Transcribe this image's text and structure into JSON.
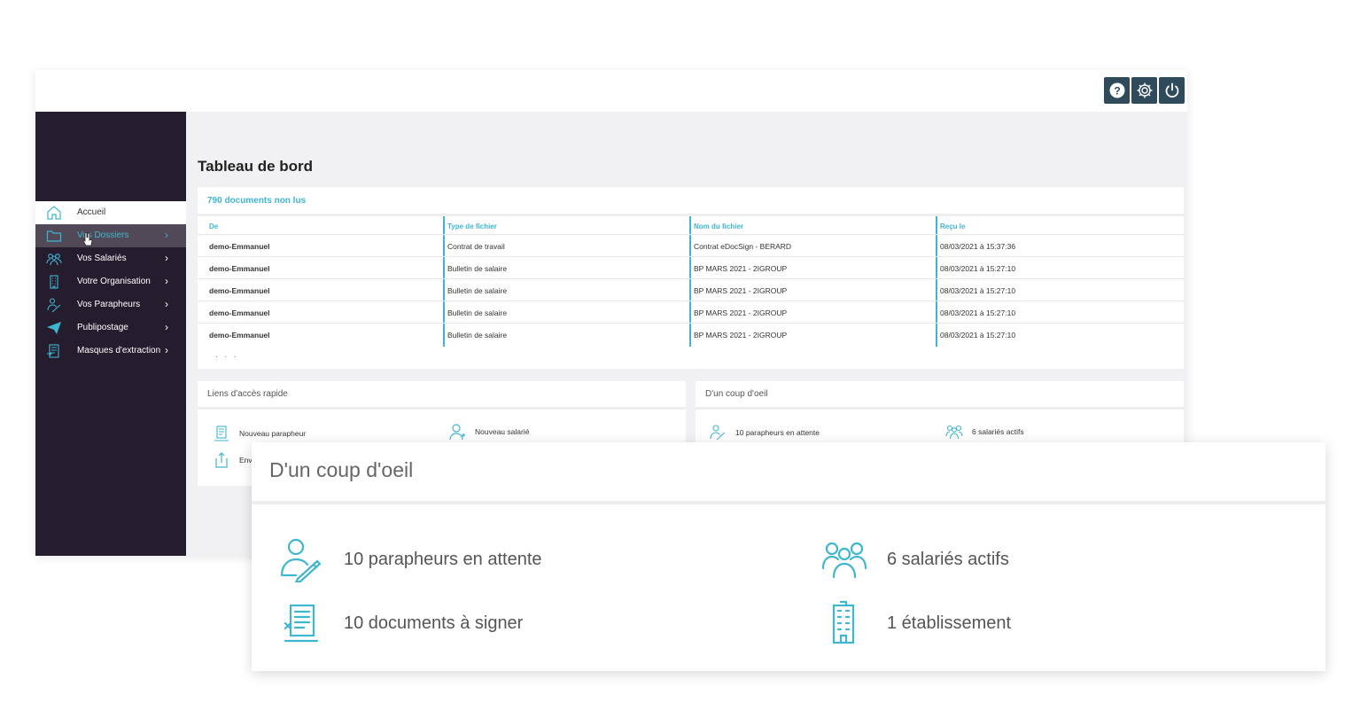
{
  "colors": {
    "accent": "#3fb6cf",
    "sidebar": "#251c2e",
    "topbar_button": "#2e4a5b"
  },
  "topbar": {
    "buttons": [
      {
        "icon": "help-icon"
      },
      {
        "icon": "gear-icon"
      },
      {
        "icon": "power-icon"
      }
    ]
  },
  "sidebar": {
    "items": [
      {
        "label": "Accueil",
        "icon": "home-icon"
      },
      {
        "label": "Vos Dossiers",
        "icon": "folder-icon"
      },
      {
        "label": "Vos Salariés",
        "icon": "users-icon"
      },
      {
        "label": "Votre Organisation",
        "icon": "building-icon"
      },
      {
        "label": "Vos Parapheurs",
        "icon": "signer-icon"
      },
      {
        "label": "Publipostage",
        "icon": "send-icon"
      },
      {
        "label": "Masques d'extraction",
        "icon": "extraction-icon"
      }
    ]
  },
  "main": {
    "title": "Tableau de bord",
    "documents": {
      "header": "790 documents non lus",
      "columns": [
        "De",
        "Type de fichier",
        "Nom du fichier",
        "Reçu le"
      ],
      "rows": [
        [
          "demo-Emmanuel",
          "Contrat de travail",
          "Contrat eDocSign - BERARD",
          "08/03/2021 à 15:37:36"
        ],
        [
          "demo-Emmanuel",
          "Bulletin de salaire",
          "BP MARS 2021 - 2IGROUP",
          "08/03/2021 à 15:27:10"
        ],
        [
          "demo-Emmanuel",
          "Bulletin de salaire",
          "BP MARS 2021 - 2IGROUP",
          "08/03/2021 à 15:27:10"
        ],
        [
          "demo-Emmanuel",
          "Bulletin de salaire",
          "BP MARS 2021 - 2IGROUP",
          "08/03/2021 à 15:27:10"
        ],
        [
          "demo-Emmanuel",
          "Bulletin de salaire",
          "BP MARS 2021 - 2IGROUP",
          "08/03/2021 à 15:27:10"
        ]
      ],
      "more": "· · ·"
    },
    "quick_links": {
      "title": "Liens d'accès rapide",
      "items": [
        {
          "label": "Nouveau parapheur",
          "icon": "new-parapheur-icon"
        },
        {
          "label": "Nouveau salarié",
          "icon": "new-user-icon"
        },
        {
          "label": "Env",
          "icon": "upload-icon"
        }
      ]
    },
    "glance": {
      "title": "D'un coup d'oeil",
      "items": [
        {
          "label": "10 parapheurs en attente",
          "icon": "signer-icon"
        },
        {
          "label": "6 salariés actifs",
          "icon": "users-icon"
        }
      ]
    }
  },
  "zoom": {
    "title": "D'un coup d'oeil",
    "items": [
      {
        "label": "10 parapheurs en attente",
        "icon": "signer-icon"
      },
      {
        "label": "6 salariés actifs",
        "icon": "users-icon"
      },
      {
        "label": "10 documents à signer",
        "icon": "document-sign-icon"
      },
      {
        "label": "1 établissement",
        "icon": "building-icon"
      }
    ]
  }
}
